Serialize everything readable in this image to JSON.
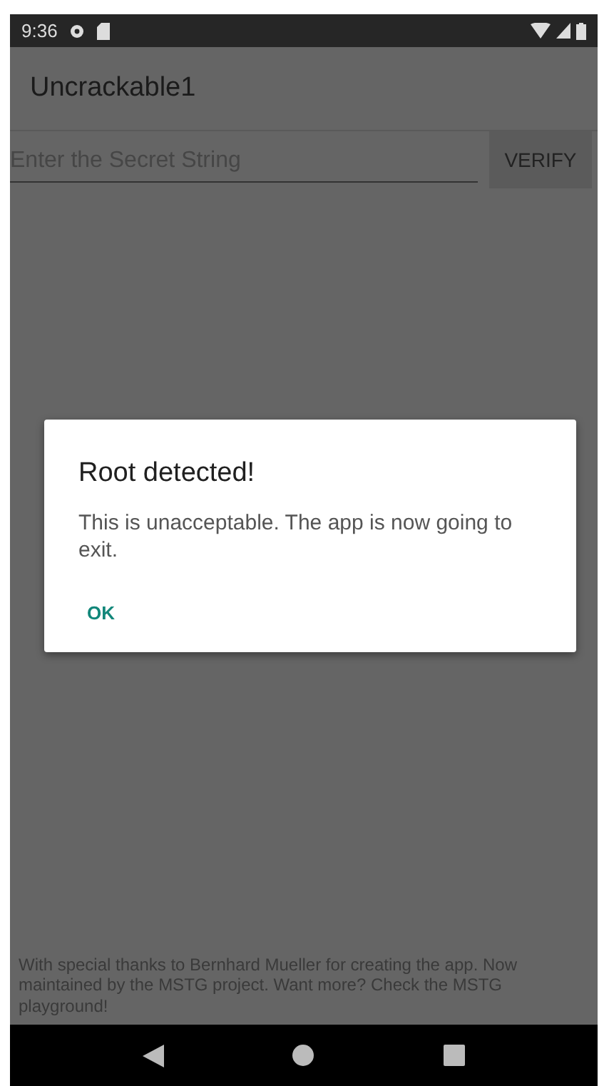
{
  "status_bar": {
    "time": "9:36"
  },
  "app_bar": {
    "title": "Uncrackable1"
  },
  "secret_field": {
    "placeholder": "Enter the Secret String"
  },
  "verify_button": {
    "label": "VERIFY"
  },
  "dialog": {
    "title": "Root detected!",
    "message": "This is unacceptable. The app is now going to exit.",
    "button": "OK"
  },
  "footer": {
    "text": "With special thanks to Bernhard Mueller for creating the app. Now maintained by the MSTG project. Want more? Check the MSTG playground!"
  }
}
